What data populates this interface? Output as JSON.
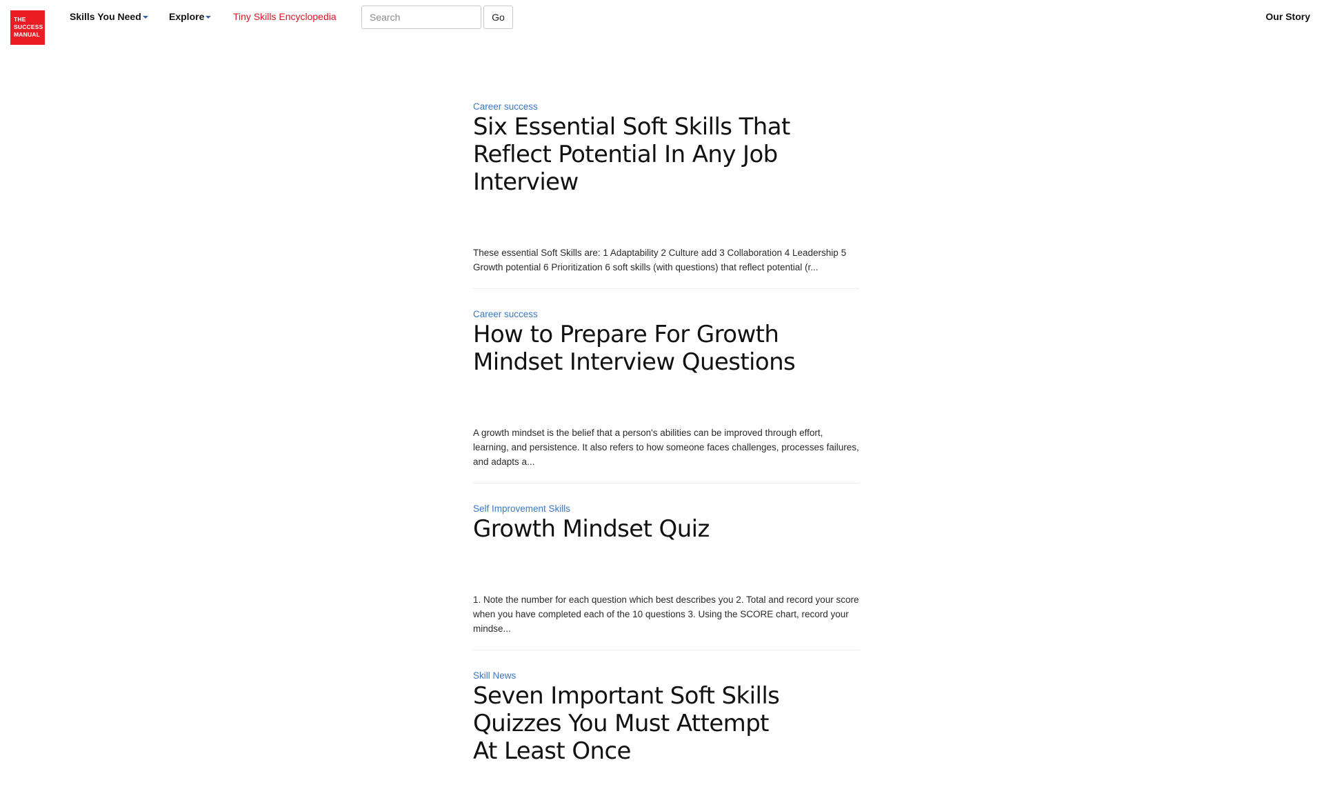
{
  "logo": {
    "line1": "THE",
    "line2": "SUCCESS",
    "line3": "MANUAL",
    "color": "#ee1c25"
  },
  "nav": {
    "skills": "Skills You Need",
    "explore": "Explore",
    "encyclopedia": "Tiny Skills Encyclopedia",
    "search_placeholder": "Search",
    "go": "Go",
    "our_story": "Our Story"
  },
  "articles": [
    {
      "category": "Career success",
      "title": "Six Essential Soft Skills That Reflect Potential In Any Job Interview",
      "excerpt": "These essential Soft Skills  are: 1 Adaptability 2 Culture add 3 Collaboration 4 Leadership 5 Growth potential 6 Prioritization 6 soft skills (with questions) that reflect potential (r..."
    },
    {
      "category": "Career success",
      "title": "How to Prepare For Growth Mindset Interview Questions",
      "excerpt": "A growth mindset is the belief that a person's abilities can be improved through effort, learning, and persistence. It also refers to how someone faces challenges, processes failures, and adapts a..."
    },
    {
      "category": "Self Improvement Skills",
      "title": "Growth Mindset Quiz",
      "excerpt": "1.  Note the number for each question which best describes you  2. Total and record your score when you have completed each of the 10 questions 3. Using the SCORE chart, record your mindse..."
    },
    {
      "category": "Skill News",
      "title": "Seven Important Soft Skills Quizzes You Must Attempt At Least Once",
      "excerpt": ""
    }
  ],
  "colors": {
    "category_link": "#3a77c4",
    "encyclopedia_link": "#e0141e",
    "caret": "#3b5da8"
  }
}
